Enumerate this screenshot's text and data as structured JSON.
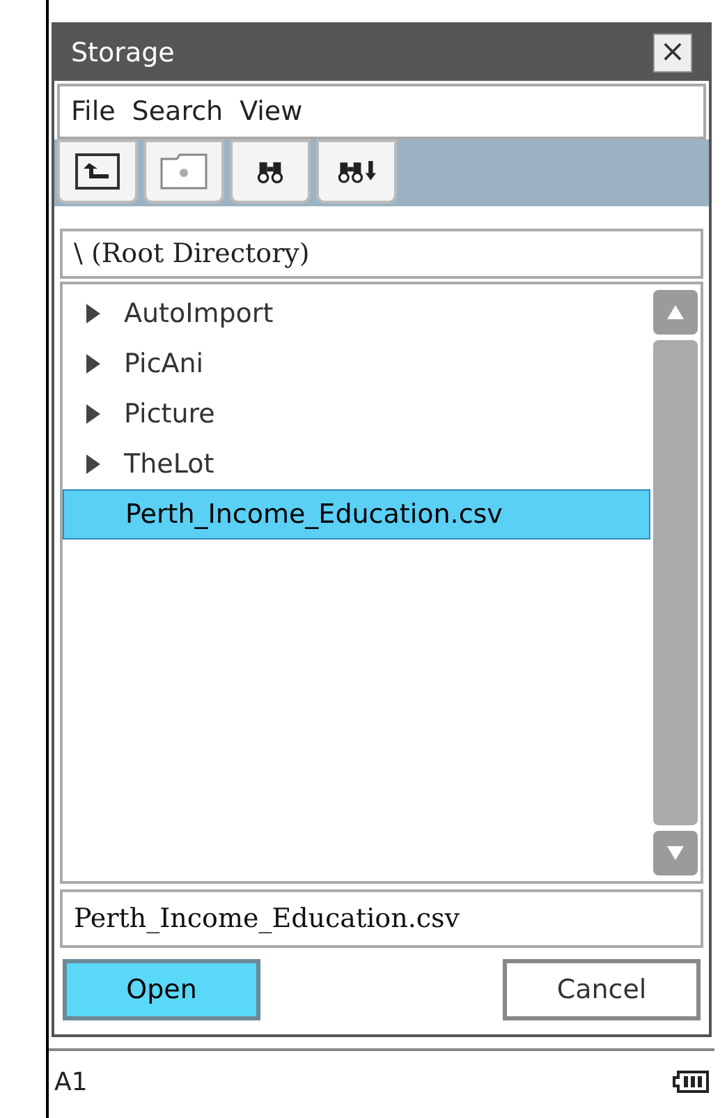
{
  "window": {
    "title": "Storage",
    "close": "×"
  },
  "menu": [
    "File",
    "Search",
    "View"
  ],
  "path": "\\ (Root Directory)",
  "items": [
    {
      "kind": "folder",
      "name": "AutoImport",
      "selected": false
    },
    {
      "kind": "folder",
      "name": "PicAni",
      "selected": false
    },
    {
      "kind": "folder",
      "name": "Picture",
      "selected": false
    },
    {
      "kind": "folder",
      "name": "TheLot",
      "selected": false
    },
    {
      "kind": "file",
      "name": "Perth_Income_Education.csv",
      "selected": true
    }
  ],
  "filename": "Perth_Income_Education.csv",
  "buttons": [
    {
      "label": "Open",
      "selected": true
    },
    {
      "label": "Cancel",
      "selected": false
    }
  ],
  "status_bar": {
    "cell": "A1"
  }
}
